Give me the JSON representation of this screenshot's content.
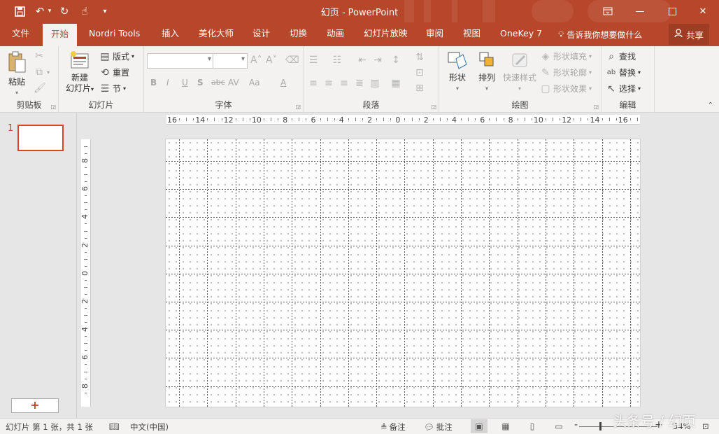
{
  "title_bar": {
    "title": "幻页  -  PowerPoint",
    "icons": [
      "save-icon",
      "undo-icon",
      "redo-icon",
      "touch-mode-icon",
      "customize-qat-icon"
    ],
    "window_controls": [
      "ribbon-display-icon",
      "minimize-icon",
      "maximize-icon",
      "close-icon"
    ]
  },
  "tabs": {
    "file": "文件",
    "items": [
      "开始",
      "Nordri Tools",
      "插入",
      "美化大师",
      "设计",
      "切换",
      "动画",
      "幻灯片放映",
      "审阅",
      "视图",
      "OneKey 7"
    ],
    "active": "开始",
    "tell_me": "告诉我你想要做什么",
    "share": "共享"
  },
  "ribbon": {
    "clipboard": {
      "label": "剪贴板",
      "paste": "粘贴"
    },
    "slides": {
      "label": "幻灯片",
      "new_slide_line1": "新建",
      "new_slide_line2": "幻灯片",
      "layout": "版式",
      "reset": "重置",
      "section": "节"
    },
    "font": {
      "label": "字体",
      "font_name": "",
      "font_size": "",
      "bold": "B",
      "italic": "I",
      "underline": "U",
      "shadow": "S",
      "strike": "abc",
      "spacing": "AV",
      "case": "Aa",
      "color": "A"
    },
    "paragraph": {
      "label": "段落"
    },
    "drawing": {
      "label": "绘图",
      "shapes": "形状",
      "arrange": "排列",
      "quick_styles": "快速样式",
      "shape_fill": "形状填充",
      "shape_outline": "形状轮廓",
      "shape_effects": "形状效果"
    },
    "editing": {
      "label": "编辑",
      "find": "查找",
      "replace": "替换",
      "select": "选择"
    }
  },
  "rulers": {
    "horizontal": [
      "16",
      "14",
      "12",
      "10",
      "8",
      "6",
      "4",
      "2",
      "0",
      "2",
      "4",
      "6",
      "8",
      "10",
      "12",
      "14",
      "16"
    ],
    "vertical": [
      "8",
      "6",
      "4",
      "2",
      "0",
      "2",
      "4",
      "6",
      "8"
    ]
  },
  "thumbnail": {
    "number": "1",
    "new_slide_symbol": "+"
  },
  "status_bar": {
    "slide_info": "幻灯片 第 1 张，共 1 张",
    "language": "中文(中国)",
    "notes": "备注",
    "comments": "批注",
    "zoom_minus": "-",
    "zoom_plus": "+",
    "zoom": "54%"
  },
  "watermark": "头条号 / 幻页"
}
